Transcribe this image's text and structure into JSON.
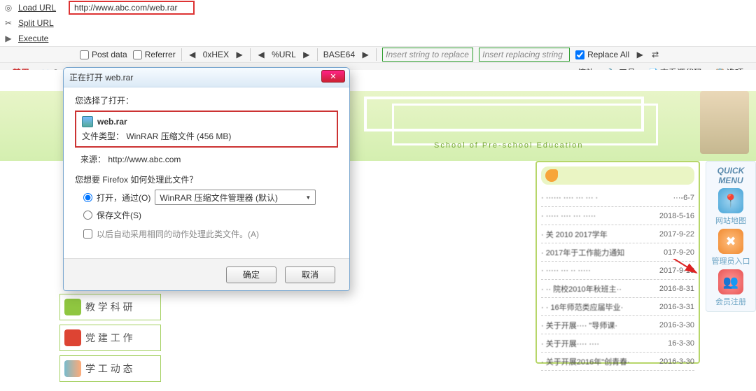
{
  "hackbar": {
    "load_label": "Load URL",
    "split_label": "Split URL",
    "execute_label": "Execute",
    "url_value": "http://www.abc.com/web.rar",
    "post_data": "Post data",
    "referrer": "Referrer",
    "hex": "0xHEX",
    "urlenc": "%URL",
    "base64": "BASE64",
    "insert_find_placeholder": "Insert string to replace",
    "insert_repl_placeholder": "Insert replacing string",
    "replace_all": "Replace All"
  },
  "browserbar": {
    "forbid": "禁用",
    "co_prefix": "Co",
    "zoom": "缩放",
    "tools": "工具",
    "view_source": "查看源代码",
    "options": "选项"
  },
  "dialog": {
    "title": "正在打开 web.rar",
    "you_chose": "您选择了打开：",
    "filename": "web.rar",
    "file_type_label": "文件类型：",
    "file_type_value": "WinRAR 压缩文件 (456 MB)",
    "source_label": "来源：",
    "source_value": "http://www.abc.com",
    "question": "您想要 Firefox 如何处理此文件？",
    "open_label": "打开，通过(O)",
    "open_app": "WinRAR 压缩文件管理器 (默认)",
    "save_label": "保存文件(S)",
    "auto_label": "以后自动采用相同的动作处理此类文件。(A)",
    "ok": "确定",
    "cancel": "取消"
  },
  "webpage": {
    "banner_sub": "School of Pre-school Education",
    "cards": [
      "教 学 科 研",
      "党 建 工 作",
      "学 工 动 态"
    ],
    "quick_title": "QUICK\nMENU",
    "quick_items": [
      "网站地图",
      "管理员入口",
      "会员注册"
    ],
    "news": [
      {
        "t": "······ ···· ··· ··· ·",
        "d": "···-6-7"
      },
      {
        "t": "····· ···· ··· ·····",
        "d": "2018-5-16"
      },
      {
        "t": "关 2010 2017学年",
        "d": "2017-9-22"
      },
      {
        "t": "2017年于工作能力通知",
        "d": "017-9-20"
      },
      {
        "t": "····· ··· ·· ·····",
        "d": "2017-9-18"
      },
      {
        "t": "·· 院校2010年秋班主··",
        "d": "2016-8-31"
      },
      {
        "t": "· 16年师范类应届毕业·",
        "d": "2016-3-31"
      },
      {
        "t": "关于开展···· \"导师课·",
        "d": "2016-3-30"
      },
      {
        "t": "关于开展···· ····",
        "d": "16-3-30"
      },
      {
        "t": "关于开展2016年\"创青春·",
        "d": "2016-3-30"
      }
    ]
  }
}
